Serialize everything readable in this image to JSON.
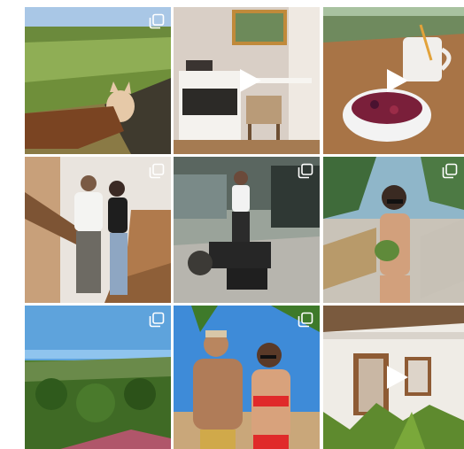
{
  "grid": {
    "items": [
      {
        "type": "carousel",
        "icon": "carousel-icon",
        "subject": "dog-in-field"
      },
      {
        "type": "video",
        "icon": "play-icon",
        "subject": "room-with-desk"
      },
      {
        "type": "video",
        "icon": "play-icon",
        "subject": "acai-bowl-and-mug"
      },
      {
        "type": "carousel",
        "icon": "carousel-icon",
        "subject": "couple-on-stairs"
      },
      {
        "type": "carousel",
        "icon": "carousel-icon",
        "subject": "musician-outdoors"
      },
      {
        "type": "carousel",
        "icon": "carousel-icon",
        "subject": "woman-with-coconut"
      },
      {
        "type": "carousel",
        "icon": "carousel-icon",
        "subject": "jungle-landscape"
      },
      {
        "type": "carousel",
        "icon": "carousel-icon",
        "subject": "couple-on-beach"
      },
      {
        "type": "video",
        "icon": "play-icon",
        "subject": "white-house-facade"
      }
    ]
  },
  "colors": {
    "overlay_icon": "#ffffff",
    "background": "#ffffff"
  }
}
